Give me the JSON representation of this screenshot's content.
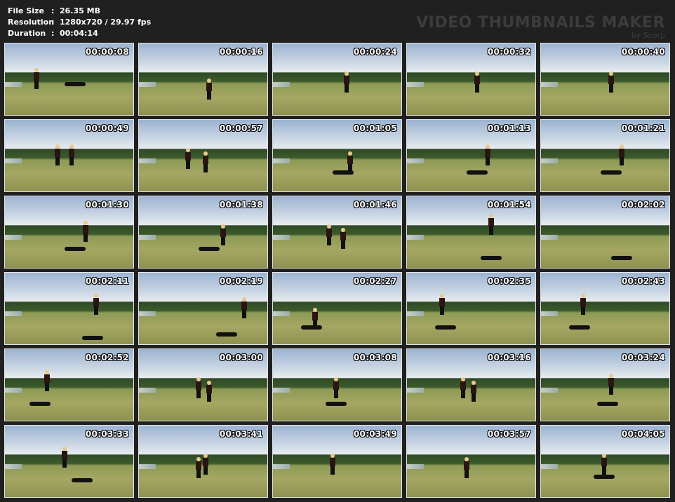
{
  "info": {
    "file_size_label": "File Size",
    "file_size_value": "26.35 MB",
    "resolution_label": "Resolution",
    "resolution_value": "1280x720 / 29.97 fps",
    "duration_label": "Duration",
    "duration_value": "00:04:14",
    "separator": ":"
  },
  "brand": {
    "title": "VIDEO THUMBNAILS MAKER",
    "subtitle": "by Scorp"
  },
  "thumbnails": [
    "00:00:08",
    "00:00:16",
    "00:00:24",
    "00:00:32",
    "00:00:40",
    "00:00:49",
    "00:00:57",
    "00:01:05",
    "00:01:13",
    "00:01:21",
    "00:01:30",
    "00:01:38",
    "00:01:46",
    "00:01:54",
    "00:02:02",
    "00:02:11",
    "00:02:19",
    "00:02:27",
    "00:02:35",
    "00:02:43",
    "00:02:52",
    "00:03:00",
    "00:03:08",
    "00:03:16",
    "00:03:24",
    "00:03:33",
    "00:03:41",
    "00:03:49",
    "00:03:57",
    "00:04:05"
  ]
}
